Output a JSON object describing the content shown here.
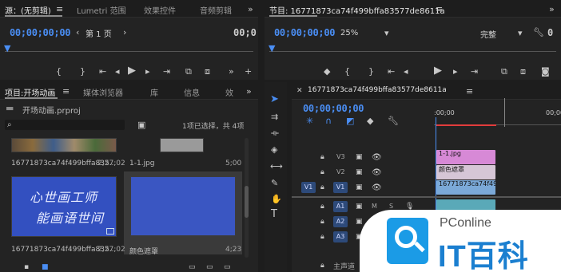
{
  "colors": {
    "accent": "#4a8ef4",
    "panel": "#232323",
    "pink_clip": "#d789d6",
    "blue_clip": "#7ba9d8",
    "playhead": "#e23c3c",
    "thumb_blue": "#3a56c2"
  },
  "source_panel": {
    "tabs": [
      "源：(无剪辑)",
      "Lumetri 范围",
      "效果控件",
      "音频剪辑"
    ],
    "timecode": "00;00;00;00",
    "page_select": "第 1 页",
    "timecode_right": "00;0"
  },
  "program_panel": {
    "title": "节目: 16771873ca74f499bffa83577de8611a",
    "timecode": "00;00;00;00",
    "zoom": "25%",
    "quality": "完整"
  },
  "project_panel": {
    "tabs": [
      "项目:开场动画",
      "媒体浏览器",
      "库",
      "信息",
      "效"
    ],
    "project_file": "开场动画.prproj",
    "selection_status": "1项已选择，共 4项",
    "items": [
      {
        "name": "16771873ca74f499bffa835...",
        "duration": "2;27;02"
      },
      {
        "name": "1-1.jpg",
        "duration": "5;00"
      },
      {
        "name": "16771873ca74f499bffa835...",
        "duration": "2;27;02"
      },
      {
        "name": "颜色遮罩",
        "duration": "4;23"
      }
    ],
    "thumb_handwriting": [
      "心世画工师",
      "能画语世间"
    ]
  },
  "timeline_panel": {
    "sequence_name": "16771873ca74f499bffa83577de8611a",
    "timecode": "00;00;00;00",
    "ruler_start": ":00;00",
    "ruler_mark": "00;00",
    "video_tracks": [
      "V3",
      "V2",
      "V1"
    ],
    "source_patch": "V1",
    "audio_tracks": [
      "A1",
      "A2",
      "A3"
    ],
    "mute_label": "M",
    "solo_label": "S",
    "master_label": "主声道",
    "clips": {
      "v3": "1-1.jpg",
      "v2": "颜色遮罩",
      "v1": "16771873ca74f499bffa83577de8611a"
    }
  },
  "watermark": {
    "brand": "PConline",
    "sub": "IT百科"
  }
}
